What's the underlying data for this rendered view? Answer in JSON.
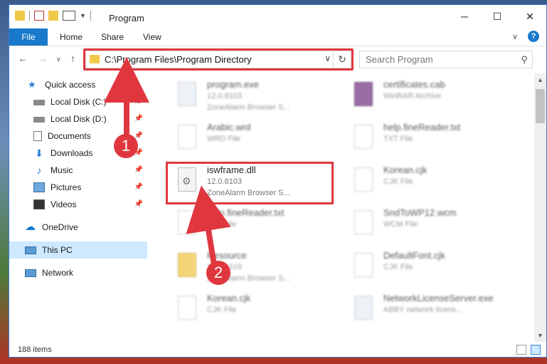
{
  "window": {
    "title": "Program",
    "minimize": "─",
    "maximize": "☐",
    "close": "✕"
  },
  "ribbon": {
    "file": "File",
    "tabs": [
      "Home",
      "Share",
      "View"
    ]
  },
  "address": {
    "path": "C:\\Program Files\\Program Directory",
    "search_placeholder": "Search Program"
  },
  "sidebar": {
    "items": [
      {
        "label": "Quick access",
        "icon": "star-icon"
      },
      {
        "label": "Local Disk (C:)",
        "icon": "drive-icon",
        "pinned": true
      },
      {
        "label": "Local Disk (D:)",
        "icon": "drive-icon",
        "pinned": true
      },
      {
        "label": "Documents",
        "icon": "documents-icon",
        "pinned": true
      },
      {
        "label": "Downloads",
        "icon": "download-icon",
        "pinned": true
      },
      {
        "label": "Music",
        "icon": "music-icon",
        "pinned": true
      },
      {
        "label": "Pictures",
        "icon": "pictures-icon",
        "pinned": true
      },
      {
        "label": "Videos",
        "icon": "videos-icon",
        "pinned": true
      },
      {
        "label": "OneDrive",
        "icon": "cloud-icon"
      },
      {
        "label": "This PC",
        "icon": "computer-icon",
        "selected": true
      },
      {
        "label": "Network",
        "icon": "network-icon"
      }
    ]
  },
  "files": [
    {
      "name": "program.exe",
      "line2": "12.0.8103",
      "line3": "ZoneAlarm Browser S...",
      "icon": "exe-icon"
    },
    {
      "name": "certificates.cab",
      "line2": "WinRAR Archive",
      "line3": "",
      "icon": "archive-icon"
    },
    {
      "name": "Arabic.wrd",
      "line2": "WRD File",
      "line3": "",
      "icon": "file-icon"
    },
    {
      "name": "help.fineReader.txt",
      "line2": "TXT File",
      "line3": "",
      "icon": "file-icon"
    },
    {
      "name": "iswframe.dll",
      "line2": "12.0.8103",
      "line3": "ZoneAlarm Browser S...",
      "icon": "dll-icon"
    },
    {
      "name": "Korean.cjk",
      "line2": "CJK File",
      "line3": "",
      "icon": "file-icon"
    },
    {
      "name": "help.fineReader.txt",
      "line2": "TXT File",
      "line3": "",
      "icon": "file-icon"
    },
    {
      "name": "SndToWP12.wcm",
      "line2": "WCM File",
      "line3": "",
      "icon": "file-icon"
    },
    {
      "name": "Resource",
      "line2": "12.0.8103",
      "line3": "ZoneAlarm Browser S...",
      "icon": "folder-icon"
    },
    {
      "name": "DefaultFont.cjk",
      "line2": "CJK File",
      "line3": "",
      "icon": "file-icon"
    },
    {
      "name": "Korean.cjk",
      "line2": "CJK File",
      "line3": "",
      "icon": "file-icon"
    },
    {
      "name": "NetworkLicenseServer.exe",
      "line2": "ABBY network licens...",
      "line3": "",
      "icon": "exe-icon"
    }
  ],
  "annotations": {
    "step1": "1",
    "step2": "2"
  },
  "status": {
    "count": "188 items"
  }
}
